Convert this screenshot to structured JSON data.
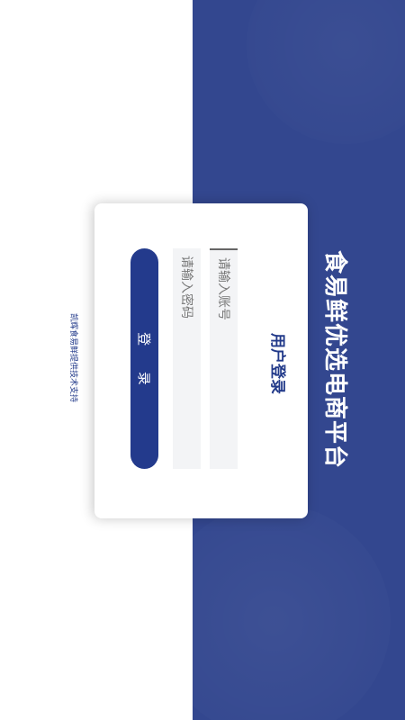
{
  "app": {
    "platform_title": "食易鲜优选电商平台",
    "accent_color": "#33478f",
    "button_color": "#233a8c"
  },
  "login": {
    "title": "用户登录",
    "account_placeholder": "请输入账号",
    "password_placeholder": "请输入密码",
    "submit_label": "登 录"
  },
  "footer": {
    "support_text": "凯辉食易鲜提供技术支持"
  }
}
